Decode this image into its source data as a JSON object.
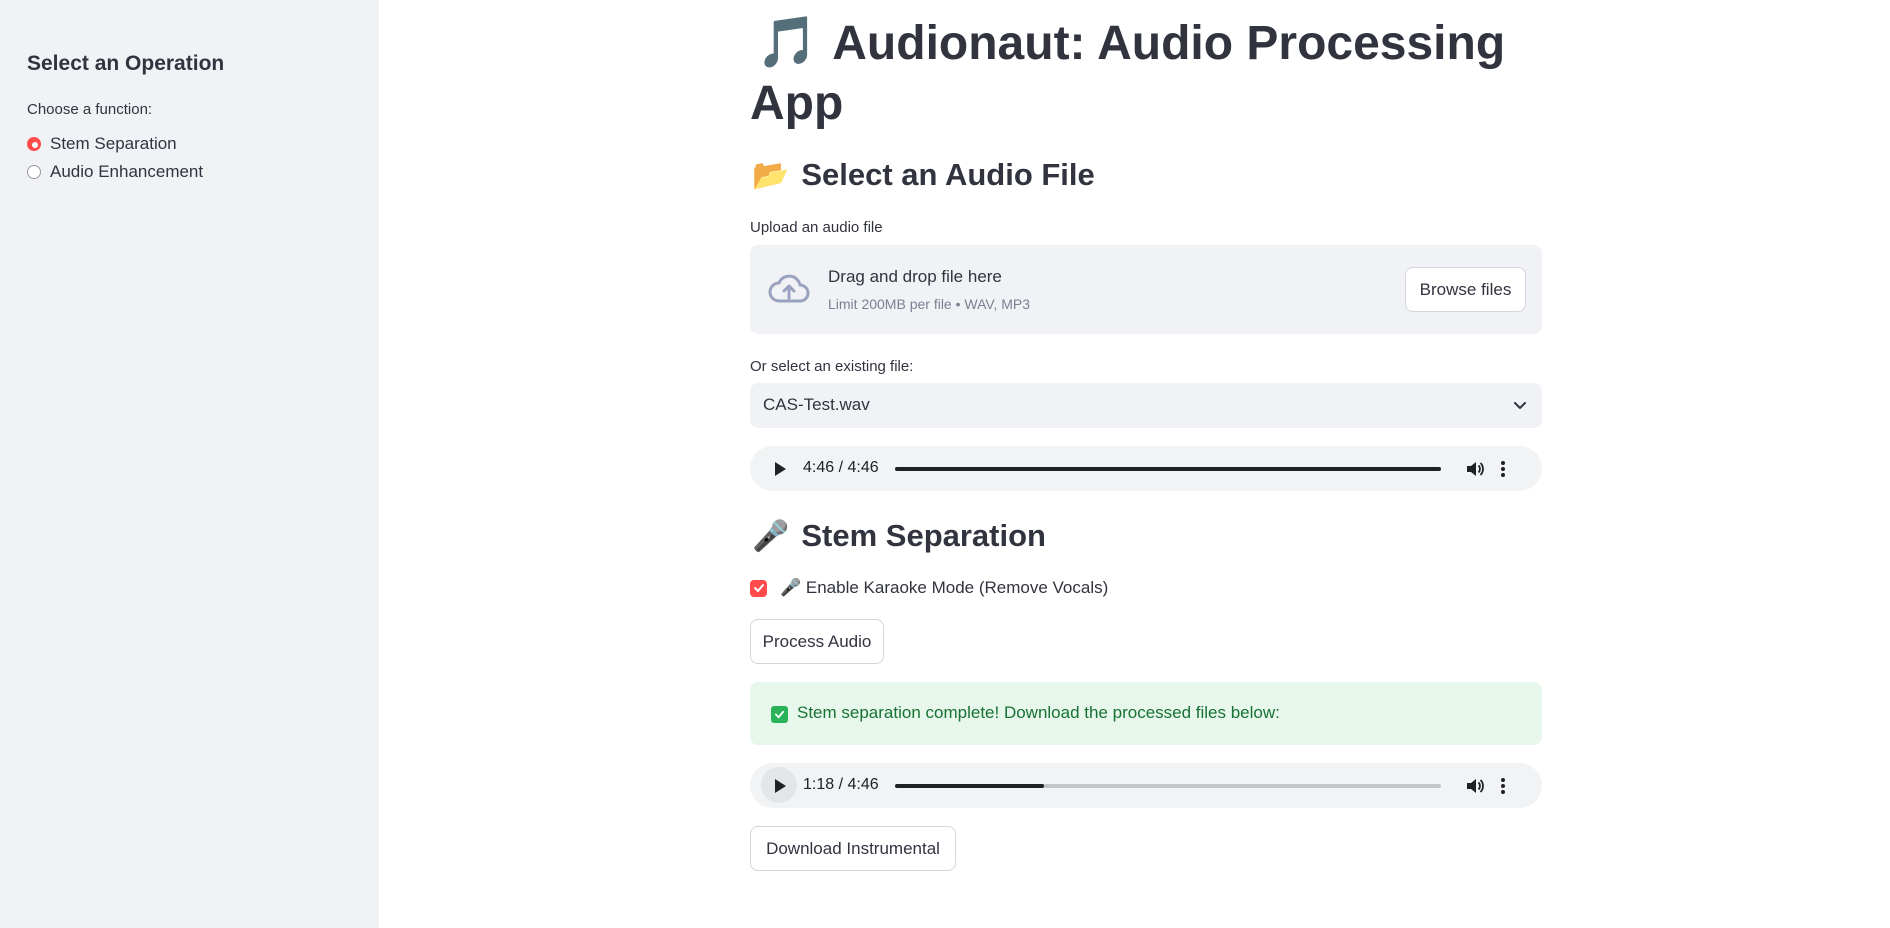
{
  "sidebar": {
    "title": "Select an Operation",
    "radio_label": "Choose a function:",
    "options": [
      {
        "label": "Stem Separation",
        "selected": true
      },
      {
        "label": "Audio Enhancement",
        "selected": false
      }
    ],
    "accent_color": "#ff4b4b"
  },
  "main": {
    "title_emoji": "🎵",
    "title": "Audionaut: Audio Processing App",
    "select_section": {
      "icon": "📂",
      "heading": "Select an Audio File",
      "upload_label": "Upload an audio file",
      "dropzone_main": "Drag and drop file here",
      "dropzone_sub": "Limit 200MB per file • WAV, MP3",
      "browse_label": "Browse files",
      "existing_label": "Or select an existing file:",
      "selected_file": "CAS-Test.wav"
    },
    "player1": {
      "time": "4:46 / 4:46",
      "progress": 1.0
    },
    "stem_section": {
      "icon": "🎤",
      "heading": "Stem Separation",
      "karaoke_label": "🎤 Enable Karaoke Mode (Remove Vocals)",
      "karaoke_checked": true,
      "process_label": "Process Audio",
      "success_message": "Stem separation complete! Download the processed files below:",
      "success_color": "#177233"
    },
    "player2": {
      "time": "1:18 / 4:46",
      "progress": 0.2727
    },
    "download_label": "Download Instrumental"
  }
}
